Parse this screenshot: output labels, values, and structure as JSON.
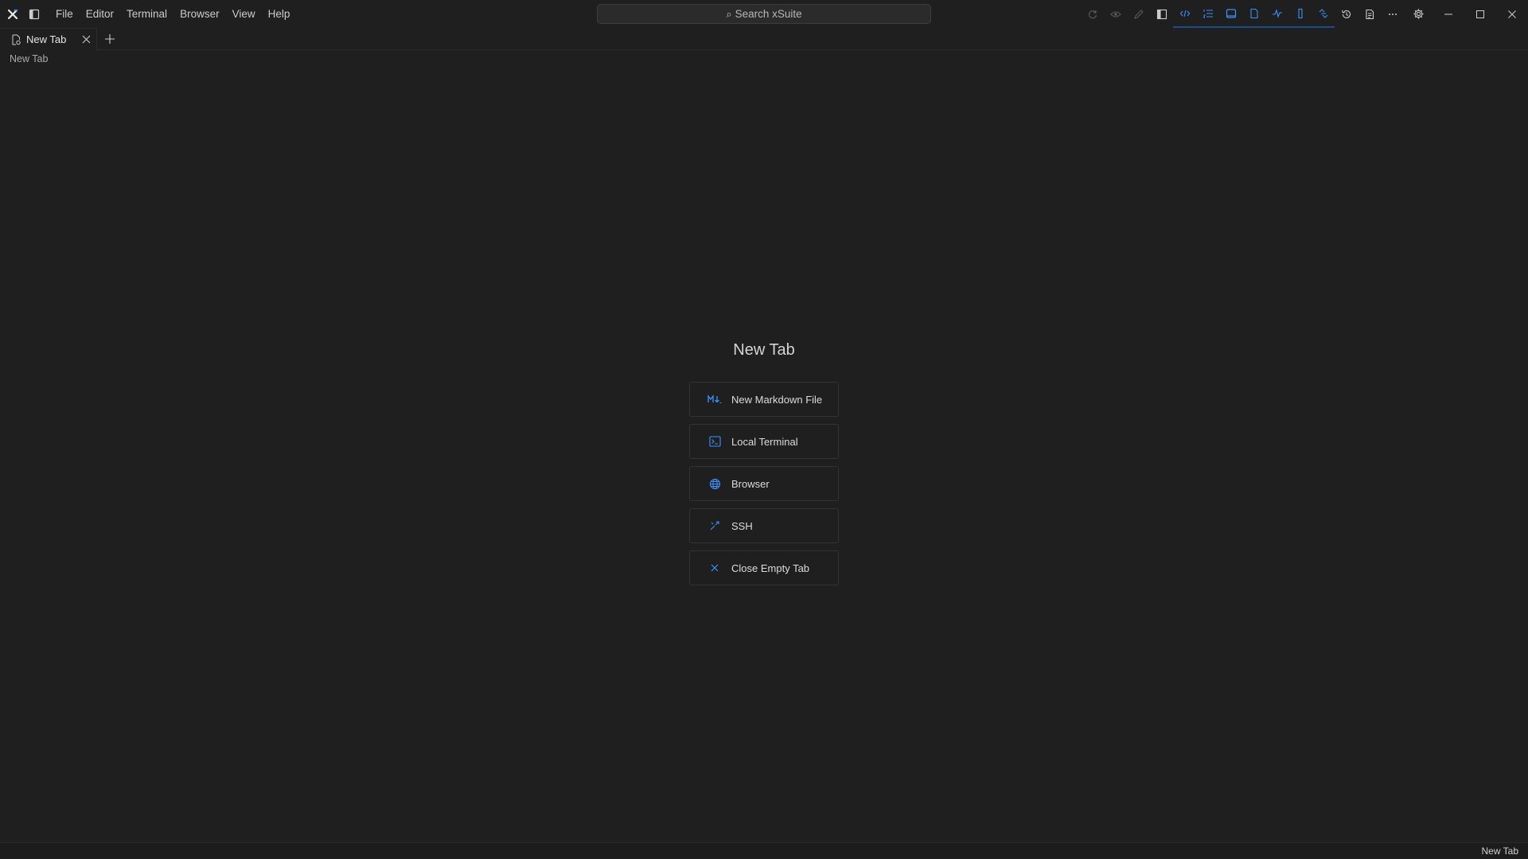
{
  "app": {
    "name": "xSuite"
  },
  "menu": {
    "items": [
      {
        "label": "File"
      },
      {
        "label": "Editor"
      },
      {
        "label": "Terminal"
      },
      {
        "label": "Browser"
      },
      {
        "label": "View"
      },
      {
        "label": "Help"
      }
    ]
  },
  "search": {
    "label": "Search xSuite",
    "glyph": "⌕"
  },
  "toolbar": {
    "icons": [
      {
        "name": "sync-icon",
        "active": false,
        "disabled": true
      },
      {
        "name": "eye-icon",
        "active": false,
        "disabled": true
      },
      {
        "name": "pencil-icon",
        "active": false,
        "disabled": true
      },
      {
        "name": "sidebar-left-icon",
        "active": false
      },
      {
        "name": "code-icon",
        "active": true
      },
      {
        "name": "list-numbered-icon",
        "active": true
      },
      {
        "name": "panel-icon",
        "active": true
      },
      {
        "name": "file-icon",
        "active": true
      },
      {
        "name": "activity-icon",
        "active": true
      },
      {
        "name": "column-icon",
        "active": true
      },
      {
        "name": "link-icon",
        "active": true
      },
      {
        "name": "history-icon",
        "active": false
      },
      {
        "name": "notes-icon",
        "active": false
      },
      {
        "name": "more-icon",
        "active": false
      },
      {
        "name": "gear-icon",
        "active": false
      }
    ]
  },
  "tabs": [
    {
      "label": "New Tab",
      "active": true
    }
  ],
  "breadcrumb": {
    "label": "New Tab"
  },
  "main": {
    "title": "New Tab",
    "actions": [
      {
        "label": "New Markdown File",
        "icon": "markdown-icon"
      },
      {
        "label": "Local Terminal",
        "icon": "terminal-icon"
      },
      {
        "label": "Browser",
        "icon": "globe-icon"
      },
      {
        "label": "SSH",
        "icon": "ssh-icon"
      },
      {
        "label": "Close Empty Tab",
        "icon": "close-icon"
      }
    ]
  },
  "status": {
    "right_label": "New Tab"
  },
  "colors": {
    "background": "#1f1f1f",
    "accent": "#3794ff",
    "active_underline": "#1b4f8c",
    "border": "#333333",
    "text": "#cccccc"
  }
}
